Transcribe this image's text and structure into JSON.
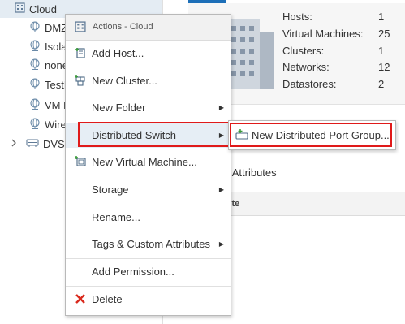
{
  "tree": {
    "root_label": "Cloud",
    "items": [
      {
        "label": "DMZ",
        "icon": "network-globe-icon"
      },
      {
        "label": "Isola",
        "icon": "network-globe-icon"
      },
      {
        "label": "none",
        "icon": "network-globe-icon"
      },
      {
        "label": "TestN",
        "icon": "network-globe-icon"
      },
      {
        "label": "VM N",
        "icon": "network-globe-icon"
      },
      {
        "label": "Wire",
        "icon": "network-globe-icon"
      },
      {
        "label": "DVS",
        "icon": "distributed-switch-icon"
      }
    ]
  },
  "summary": {
    "rows": [
      {
        "key": "Hosts:",
        "value": "1"
      },
      {
        "key": "Virtual Machines:",
        "value": "25"
      },
      {
        "key": "Clusters:",
        "value": "1"
      },
      {
        "key": "Networks:",
        "value": "12"
      },
      {
        "key": "Datastores:",
        "value": "2"
      }
    ]
  },
  "attributes": {
    "title": "m Attributes",
    "column_header": "bute"
  },
  "menu": {
    "header": "Actions - Cloud",
    "items": [
      {
        "label": "Add Host...",
        "icon": "add-host-icon"
      },
      {
        "label": "New Cluster...",
        "icon": "new-cluster-icon"
      },
      {
        "label": "New Folder",
        "icon": ""
      },
      {
        "label": "Distributed Switch",
        "icon": ""
      },
      {
        "label": "New Virtual Machine...",
        "icon": "new-vm-icon"
      },
      {
        "label": "Storage",
        "icon": ""
      },
      {
        "label": "Rename...",
        "icon": ""
      },
      {
        "label": "Tags & Custom Attributes",
        "icon": ""
      },
      {
        "label": "Add Permission...",
        "icon": ""
      },
      {
        "label": "Delete",
        "icon": "delete-icon"
      }
    ]
  },
  "submenu": {
    "item_label": "New Distributed Port Group..."
  },
  "colors": {
    "highlight_red": "#e01a1a",
    "tab_accent": "#1d6fb8",
    "tree_selected": "#e4ecf3"
  }
}
